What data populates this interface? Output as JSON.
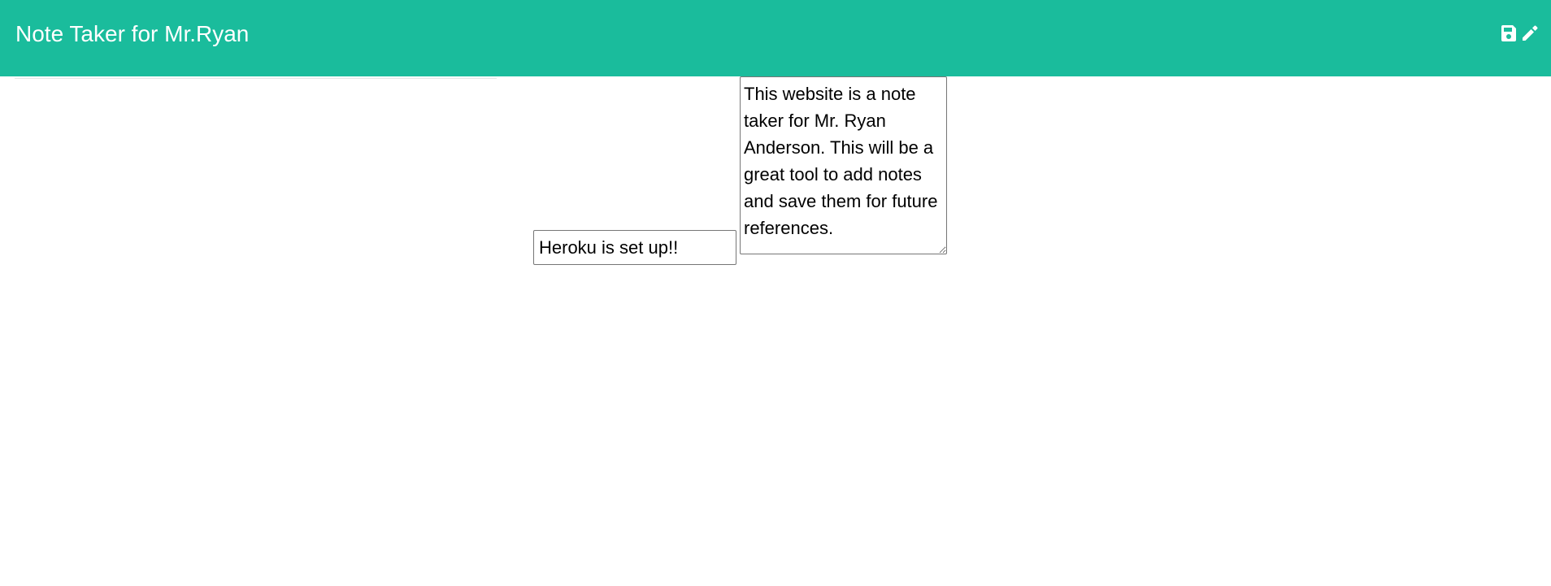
{
  "navbar": {
    "title": "Note Taker for Mr.Ryan",
    "background_color": "#1abc9c",
    "text_color": "#ffffff",
    "icons": [
      "save-icon",
      "pencil-icon"
    ]
  },
  "note": {
    "title_value": "Heroku is set up!!",
    "text_value": "This website is a note taker for Mr. Ryan Anderson. This will be a great tool to add notes and save them for future references."
  }
}
